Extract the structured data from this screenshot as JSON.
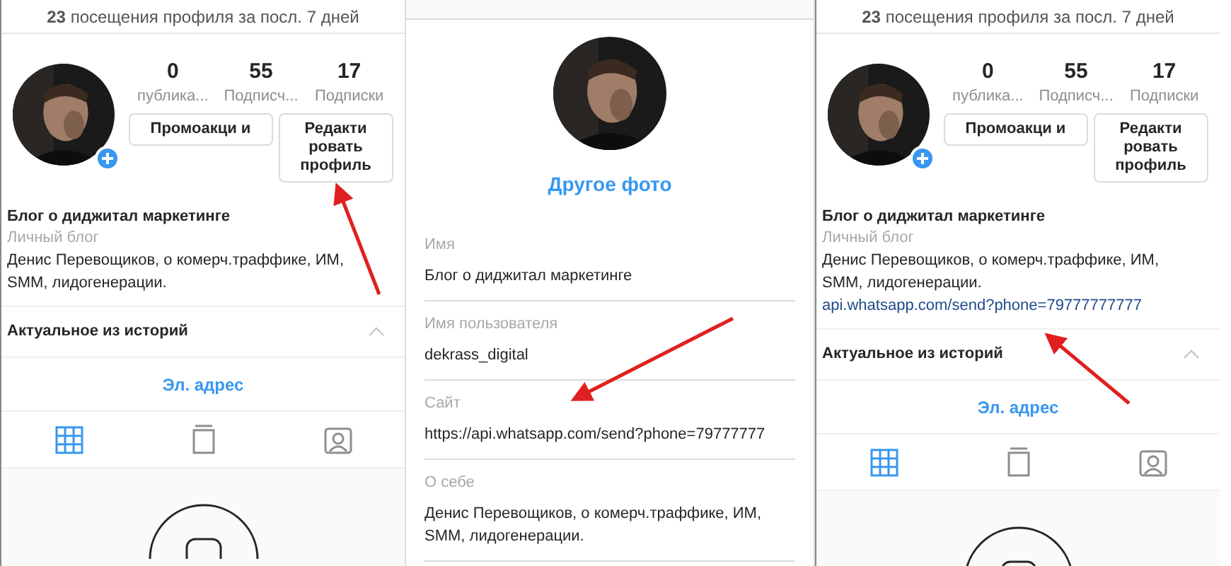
{
  "panels": [
    {
      "kind": "profile",
      "visits": "**23** посещения профиля за посл. 7 дней",
      "stats": [
        {
          "value": "0",
          "label": "публика..."
        },
        {
          "value": "55",
          "label": "Подписч..."
        },
        {
          "value": "17",
          "label": "Подписки"
        }
      ],
      "buttons": [
        "Промоакци и",
        "Редакти ровать профиль"
      ],
      "name": "Блог о диджитал маркетинге",
      "category": "Личный блог",
      "bio": "Денис Перевощиков, о комерч.траффике, ИМ, SMM, лидогенерации.",
      "highlights": "Актуальное из историй",
      "contact": "Эл. адрес",
      "tabs": [
        {
          "kind": "grid",
          "selected": true
        },
        {
          "kind": "feed",
          "selected": false
        },
        {
          "kind": "tagged",
          "selected": false
        }
      ]
    },
    {
      "kind": "edit",
      "change_photo": "Другое фото",
      "fields": [
        {
          "label": "Имя",
          "value": "Блог о диджитал маркетинге"
        },
        {
          "label": "Имя пользователя",
          "value": "dekrass_digital"
        },
        {
          "label": "Сайт",
          "value": "https://api.whatsapp.com/send?phone=79777777"
        },
        {
          "label": "О себе",
          "value": "Денис Перевощиков, о комерч.траффике, ИМ, SMM, лидогенерации."
        }
      ]
    },
    {
      "kind": "profile",
      "visits": "**23** посещения профиля за посл. 7 дней",
      "stats": [
        {
          "value": "0",
          "label": "публика..."
        },
        {
          "value": "55",
          "label": "Подписч..."
        },
        {
          "value": "17",
          "label": "Подписки"
        }
      ],
      "buttons": [
        "Промоакци и",
        "Редакти ровать профиль"
      ],
      "name": "Блог о диджитал маркетинге",
      "category": "Личный блог",
      "bio": "Денис Перевощиков, о комерч.траффике, ИМ, SMM, лидогенерации.",
      "link": "api.whatsapp.com/send?phone=79777777777",
      "highlights": "Актуальное из историй",
      "contact": "Эл. адрес",
      "tabs": [
        {
          "kind": "grid",
          "selected": true
        },
        {
          "kind": "feed",
          "selected": false
        },
        {
          "kind": "tagged",
          "selected": false
        }
      ]
    }
  ]
}
